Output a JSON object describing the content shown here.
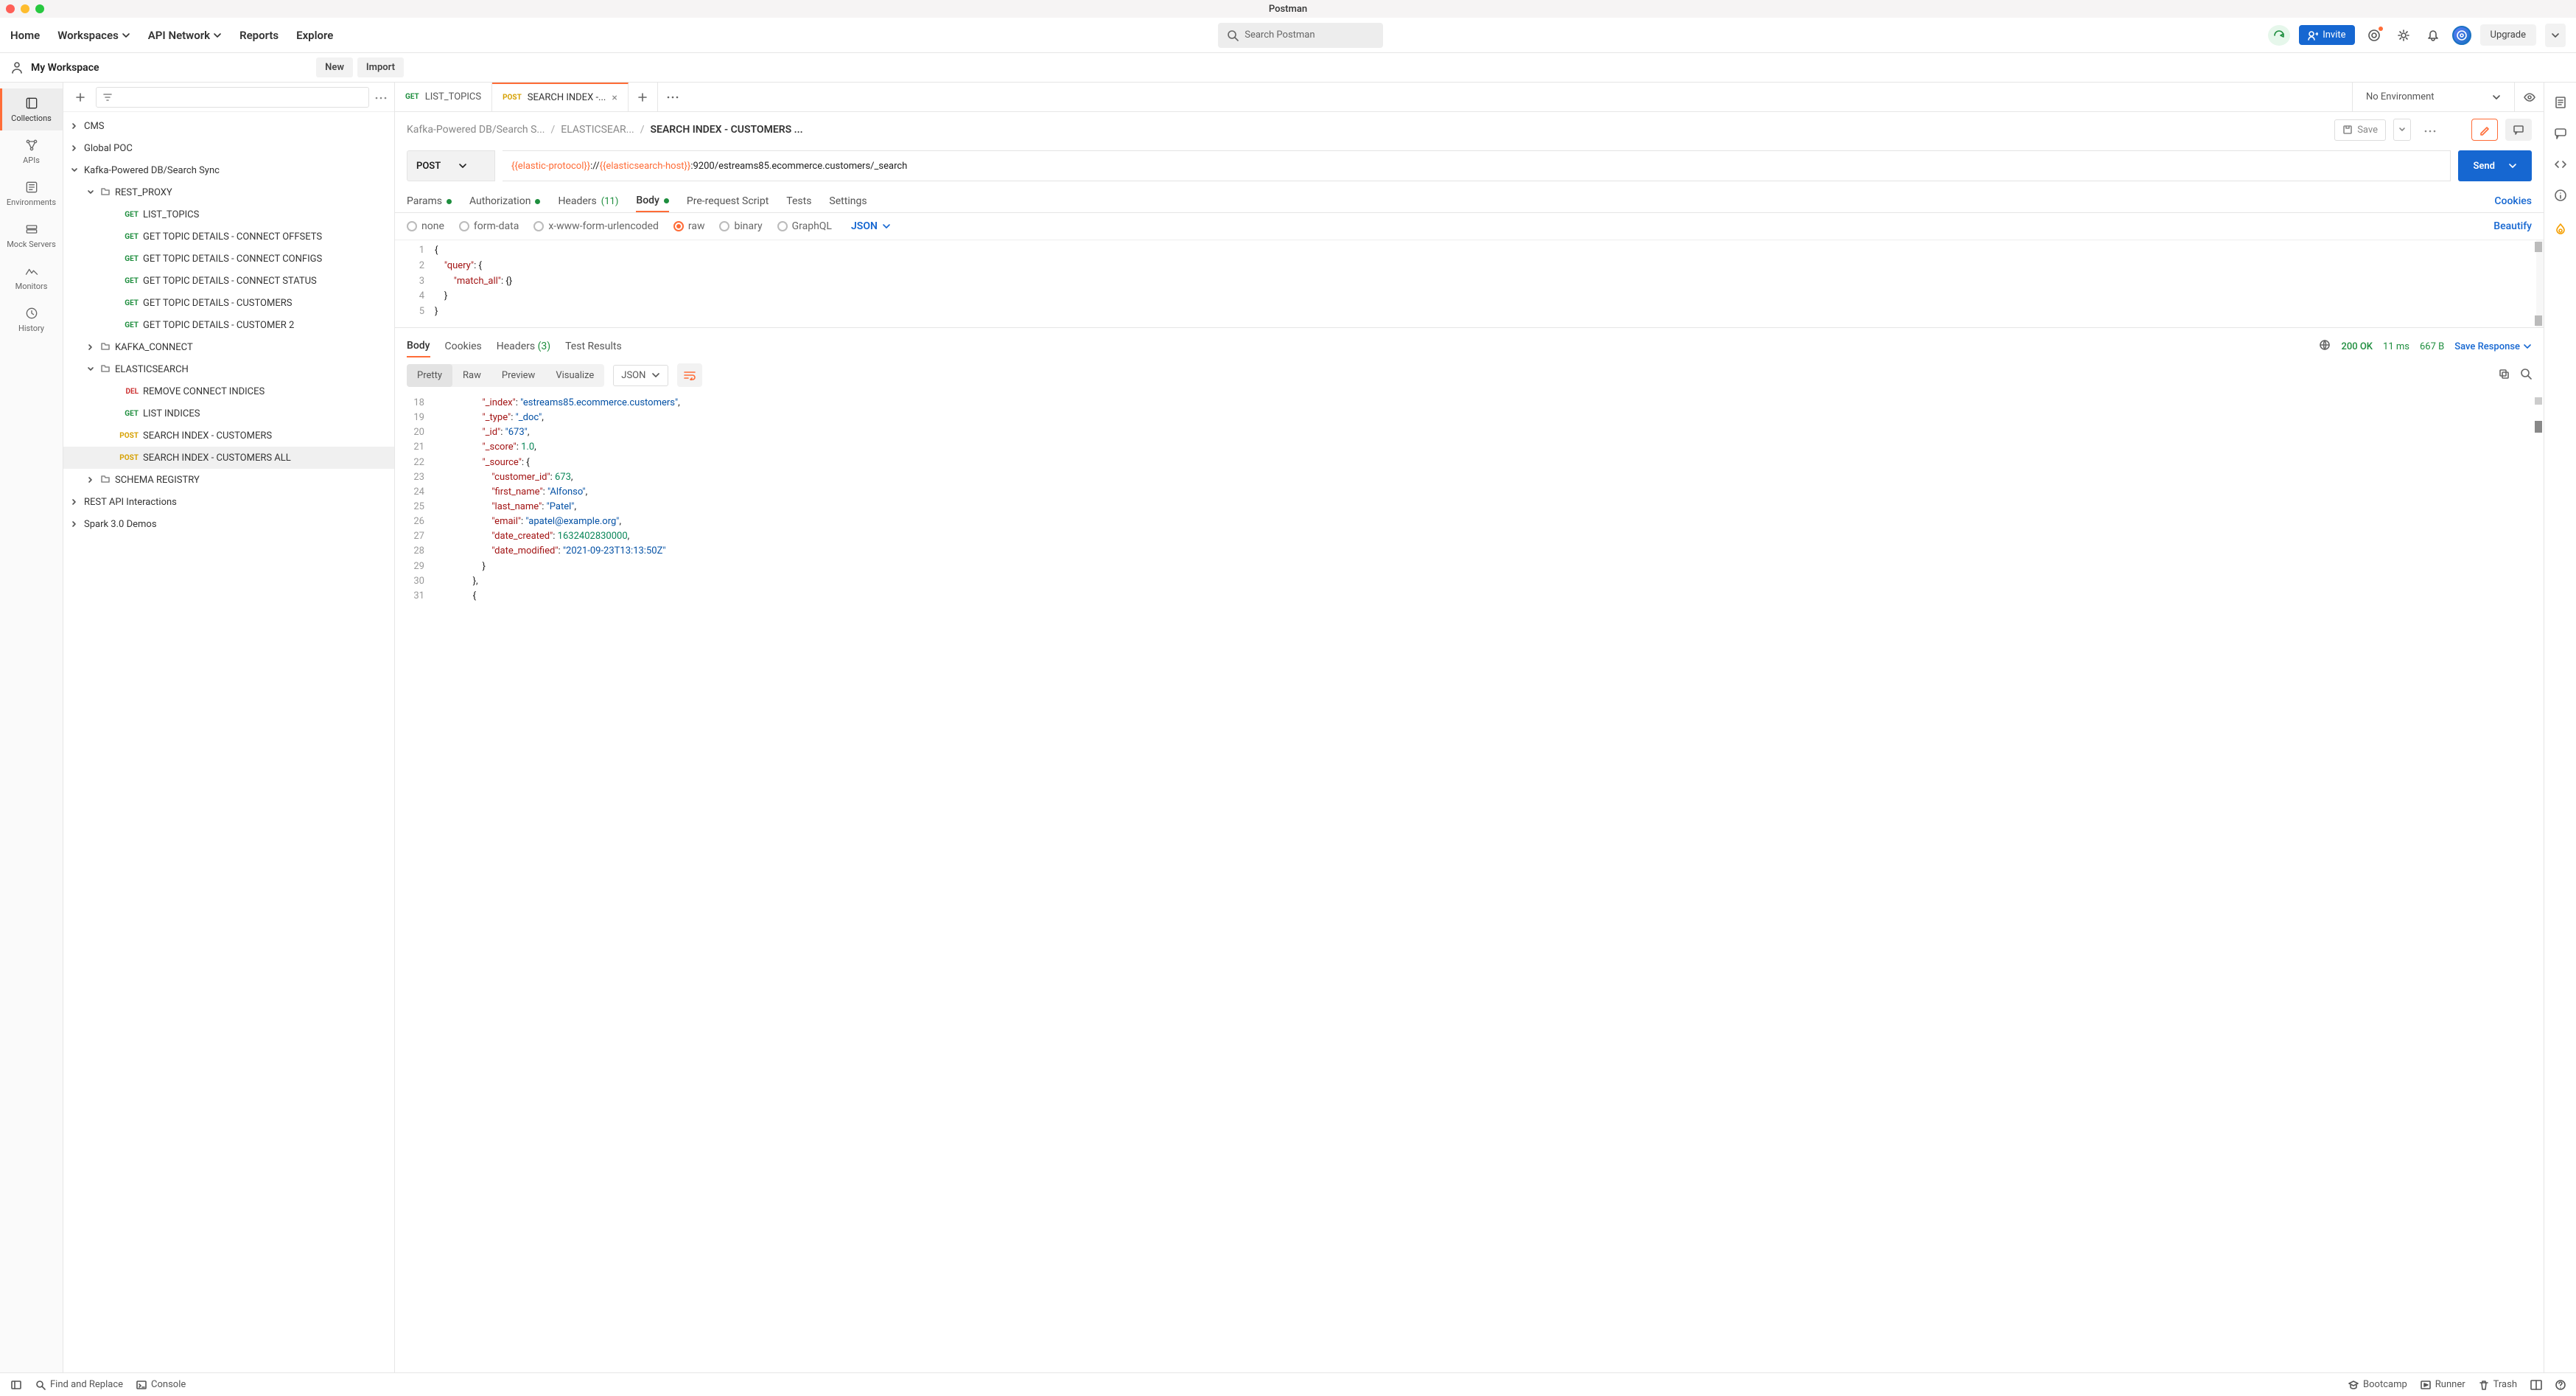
{
  "titlebar": {
    "app_name": "Postman"
  },
  "toolbar": {
    "home": "Home",
    "workspaces": "Workspaces",
    "api_network": "API Network",
    "reports": "Reports",
    "explore": "Explore",
    "search_placeholder": "Search Postman",
    "invite": "Invite",
    "upgrade": "Upgrade"
  },
  "workspace": {
    "name": "My Workspace",
    "new_btn": "New",
    "import_btn": "Import"
  },
  "nav_rail": {
    "collections": "Collections",
    "apis": "APIs",
    "environments": "Environments",
    "mock_servers": "Mock Servers",
    "monitors": "Monitors",
    "history": "History"
  },
  "sidebar": {
    "items": [
      {
        "type": "folder",
        "label": "CMS",
        "depth": 0,
        "expandable": true,
        "open": false
      },
      {
        "type": "folder",
        "label": "Global POC",
        "depth": 0,
        "expandable": true,
        "open": false
      },
      {
        "type": "folder",
        "label": "Kafka-Powered DB/Search Sync",
        "depth": 0,
        "expandable": true,
        "open": true
      },
      {
        "type": "folder",
        "label": "REST_PROXY",
        "depth": 1,
        "expandable": true,
        "open": true,
        "icon": "fld"
      },
      {
        "type": "request",
        "label": "LIST_TOPICS",
        "depth": 2,
        "method": "GET"
      },
      {
        "type": "request",
        "label": "GET TOPIC DETAILS - CONNECT OFFSETS",
        "depth": 2,
        "method": "GET"
      },
      {
        "type": "request",
        "label": "GET TOPIC DETAILS - CONNECT CONFIGS",
        "depth": 2,
        "method": "GET"
      },
      {
        "type": "request",
        "label": "GET TOPIC DETAILS - CONNECT STATUS",
        "depth": 2,
        "method": "GET"
      },
      {
        "type": "request",
        "label": "GET TOPIC DETAILS - CUSTOMERS",
        "depth": 2,
        "method": "GET"
      },
      {
        "type": "request",
        "label": "GET TOPIC DETAILS - CUSTOMER 2",
        "depth": 2,
        "method": "GET"
      },
      {
        "type": "folder",
        "label": "KAFKA_CONNECT",
        "depth": 1,
        "expandable": true,
        "open": false,
        "icon": "fld"
      },
      {
        "type": "folder",
        "label": "ELASTICSEARCH",
        "depth": 1,
        "expandable": true,
        "open": true,
        "icon": "fld"
      },
      {
        "type": "request",
        "label": "REMOVE CONNECT INDICES",
        "depth": 2,
        "method": "DEL"
      },
      {
        "type": "request",
        "label": "LIST INDICES",
        "depth": 2,
        "method": "GET"
      },
      {
        "type": "request",
        "label": "SEARCH INDEX - CUSTOMERS",
        "depth": 2,
        "method": "POST"
      },
      {
        "type": "request",
        "label": "SEARCH INDEX - CUSTOMERS ALL",
        "depth": 2,
        "method": "POST",
        "selected": true
      },
      {
        "type": "folder",
        "label": "SCHEMA REGISTRY",
        "depth": 1,
        "expandable": true,
        "open": false,
        "icon": "fld"
      },
      {
        "type": "folder",
        "label": "REST API Interactions",
        "depth": 0,
        "expandable": true,
        "open": false
      },
      {
        "type": "folder",
        "label": "Spark 3.0 Demos",
        "depth": 0,
        "expandable": true,
        "open": false
      }
    ]
  },
  "tabs": [
    {
      "method": "GET",
      "method_class": "m-get",
      "label": "LIST_TOPICS",
      "active": false
    },
    {
      "method": "POST",
      "method_class": "m-post",
      "label": "SEARCH INDEX -...",
      "active": true
    }
  ],
  "environment": {
    "selected": "No Environment"
  },
  "breadcrumb": {
    "crumbs": [
      "Kafka-Powered DB/Search S...",
      "ELASTICSEAR...",
      "SEARCH INDEX - CUSTOMERS ..."
    ],
    "save": "Save"
  },
  "request": {
    "method": "POST",
    "url_parts": {
      "var1": "{{elastic-protocol}}",
      "sep1": "://",
      "var2": "{{elasticsearch-host}}",
      "rest": ":9200/estreams85.ecommerce.customers/_search"
    },
    "send": "Send",
    "tabs": {
      "params": "Params",
      "auth": "Authorization",
      "headers_label": "Headers",
      "headers_count": "(11)",
      "body": "Body",
      "prereq": "Pre-request Script",
      "tests": "Tests",
      "settings": "Settings",
      "cookies": "Cookies"
    },
    "body_types": {
      "none": "none",
      "form_data": "form-data",
      "urlencoded": "x-www-form-urlencoded",
      "raw": "raw",
      "binary": "binary",
      "graphql": "GraphQL",
      "format": "JSON",
      "beautify": "Beautify"
    },
    "body_code": {
      "line_start": 1,
      "lines": [
        "{",
        "    \"query\": {",
        "        \"match_all\": {}",
        "    }",
        "}"
      ]
    }
  },
  "response": {
    "tabs": {
      "body": "Body",
      "cookies": "Cookies",
      "headers_label": "Headers",
      "headers_count": "(3)",
      "test_results": "Test Results"
    },
    "status_code": "200 OK",
    "time": "11 ms",
    "size": "667 B",
    "save_response": "Save Response",
    "fmt": {
      "pretty": "Pretty",
      "raw": "Raw",
      "preview": "Preview",
      "visualize": "Visualize",
      "json": "JSON"
    },
    "code": {
      "line_start": 18,
      "lines": [
        {
          "indent": 5,
          "tokens": [
            {
              "t": "key",
              "v": "\"_index\""
            },
            {
              "t": "p",
              "v": ": "
            },
            {
              "t": "str",
              "v": "\"estreams85.ecommerce.customers\""
            },
            {
              "t": "p",
              "v": ","
            }
          ]
        },
        {
          "indent": 5,
          "tokens": [
            {
              "t": "key",
              "v": "\"_type\""
            },
            {
              "t": "p",
              "v": ": "
            },
            {
              "t": "str",
              "v": "\"_doc\""
            },
            {
              "t": "p",
              "v": ","
            }
          ]
        },
        {
          "indent": 5,
          "tokens": [
            {
              "t": "key",
              "v": "\"_id\""
            },
            {
              "t": "p",
              "v": ": "
            },
            {
              "t": "str",
              "v": "\"673\""
            },
            {
              "t": "p",
              "v": ","
            }
          ]
        },
        {
          "indent": 5,
          "tokens": [
            {
              "t": "key",
              "v": "\"_score\""
            },
            {
              "t": "p",
              "v": ": "
            },
            {
              "t": "num",
              "v": "1.0"
            },
            {
              "t": "p",
              "v": ","
            }
          ]
        },
        {
          "indent": 5,
          "tokens": [
            {
              "t": "key",
              "v": "\"_source\""
            },
            {
              "t": "p",
              "v": ": {"
            }
          ]
        },
        {
          "indent": 6,
          "tokens": [
            {
              "t": "key",
              "v": "\"customer_id\""
            },
            {
              "t": "p",
              "v": ": "
            },
            {
              "t": "num",
              "v": "673"
            },
            {
              "t": "p",
              "v": ","
            }
          ]
        },
        {
          "indent": 6,
          "tokens": [
            {
              "t": "key",
              "v": "\"first_name\""
            },
            {
              "t": "p",
              "v": ": "
            },
            {
              "t": "str",
              "v": "\"Alfonso\""
            },
            {
              "t": "p",
              "v": ","
            }
          ]
        },
        {
          "indent": 6,
          "tokens": [
            {
              "t": "key",
              "v": "\"last_name\""
            },
            {
              "t": "p",
              "v": ": "
            },
            {
              "t": "str",
              "v": "\"Patel\""
            },
            {
              "t": "p",
              "v": ","
            }
          ]
        },
        {
          "indent": 6,
          "tokens": [
            {
              "t": "key",
              "v": "\"email\""
            },
            {
              "t": "p",
              "v": ": "
            },
            {
              "t": "str",
              "v": "\"apatel@example.org\""
            },
            {
              "t": "p",
              "v": ","
            }
          ]
        },
        {
          "indent": 6,
          "tokens": [
            {
              "t": "key",
              "v": "\"date_created\""
            },
            {
              "t": "p",
              "v": ": "
            },
            {
              "t": "num",
              "v": "1632402830000"
            },
            {
              "t": "p",
              "v": ","
            }
          ]
        },
        {
          "indent": 6,
          "tokens": [
            {
              "t": "key",
              "v": "\"date_modified\""
            },
            {
              "t": "p",
              "v": ": "
            },
            {
              "t": "str",
              "v": "\"2021-09-23T13:13:50Z\""
            }
          ]
        },
        {
          "indent": 5,
          "tokens": [
            {
              "t": "p",
              "v": "}"
            }
          ]
        },
        {
          "indent": 4,
          "tokens": [
            {
              "t": "p",
              "v": "},"
            }
          ]
        },
        {
          "indent": 4,
          "tokens": [
            {
              "t": "p",
              "v": "{"
            }
          ]
        }
      ]
    }
  },
  "statusbar": {
    "find_replace": "Find and Replace",
    "console": "Console",
    "bootcamp": "Bootcamp",
    "runner": "Runner",
    "trash": "Trash"
  }
}
